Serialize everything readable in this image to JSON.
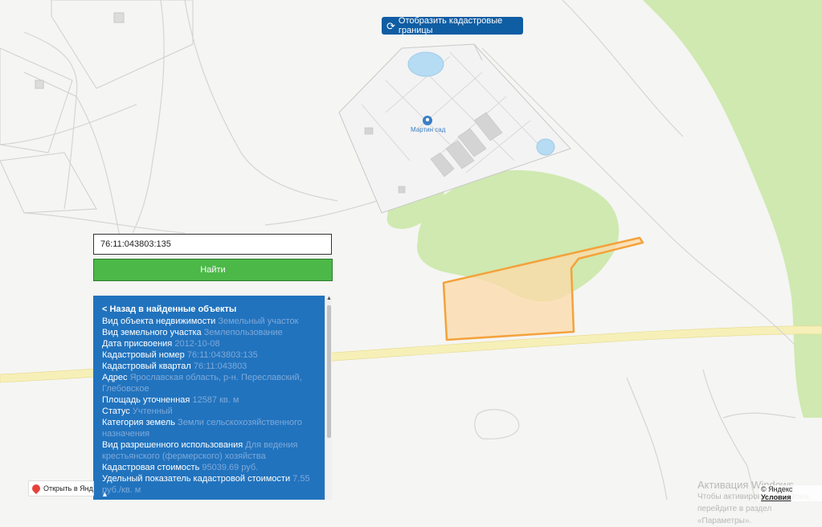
{
  "toolbar": {
    "toggle_icon": "refresh-icon",
    "toggle_label": "Отобразить кадастровые границы"
  },
  "search": {
    "value": "76:11:043803:135",
    "button_label": "Найти"
  },
  "map": {
    "poi_label": "Мартин сад",
    "parcel_color": "#f4a23c",
    "forest_color": "#cfe9b0",
    "road_color": "#f6f0b8",
    "water_color": "#b5dcf3"
  },
  "panel": {
    "back_label": "< Назад в найденные объекты",
    "rows": [
      {
        "label": "Вид объекта недвижимости",
        "value": "Земельный участок"
      },
      {
        "label": "Вид земельного участка",
        "value": "Землепользование"
      },
      {
        "label": "Дата присвоения",
        "value": "2012-10-08"
      },
      {
        "label": "Кадастровый номер",
        "value": "76:11:043803:135"
      },
      {
        "label": "Кадастровый квартал",
        "value": "76:11:043803"
      },
      {
        "label": "Адрес",
        "value": "Ярославская область, р-н. Переславский, Глебовское"
      },
      {
        "label": "Площадь уточненная",
        "value": "12587 кв. м"
      },
      {
        "label": "Статус",
        "value": "Учтенный"
      },
      {
        "label": "Категория земель",
        "value": "Земли сельскохозяйственного назначения"
      },
      {
        "label": "Вид разрешенного использования",
        "value": "Для ведения крестьянского (фермерского) хозяйства"
      },
      {
        "label": "Кадастровая стоимость",
        "value": "95039.69 руб."
      },
      {
        "label": "Удельный показатель кадастровой стоимости",
        "value": "7.55 руб./кв. м"
      }
    ],
    "scroll_up_arrow": "▲",
    "down_arrow": "▲"
  },
  "footer": {
    "open_label": "Открыть в Яндекс.Картах",
    "activation_title": "Активация Windows",
    "activation_sub": "Чтобы активировать Windows, перейдите в раздел «Параметры».",
    "copyright": "© Яндекс",
    "terms": "Условия"
  }
}
